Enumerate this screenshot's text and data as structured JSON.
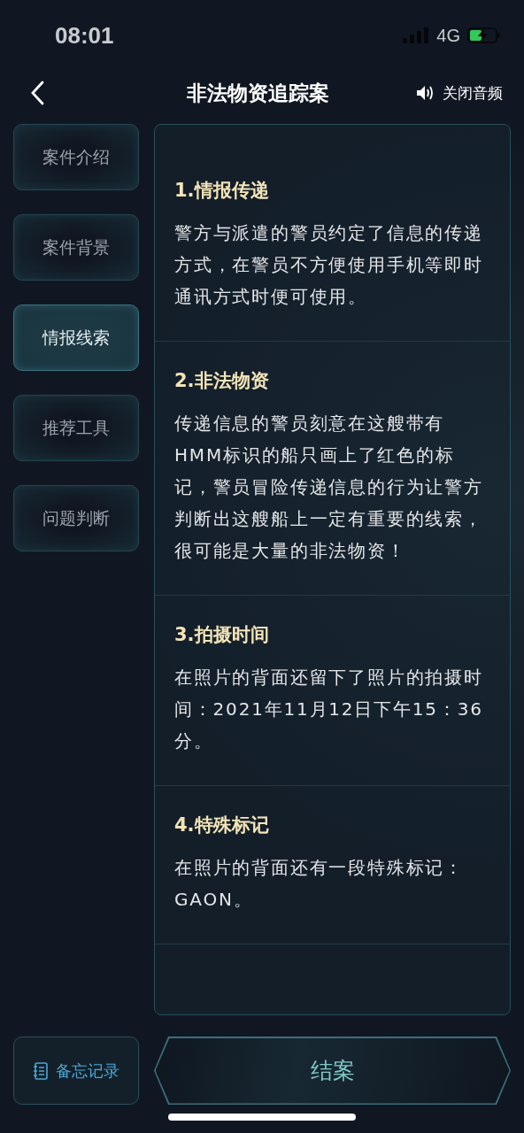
{
  "status_bar": {
    "time": "08:01",
    "network": "4G",
    "charging": true
  },
  "header": {
    "title": "非法物资追踪案",
    "audio_label": "关闭音频"
  },
  "sidebar": {
    "items": [
      {
        "label": "案件介绍",
        "selected": false
      },
      {
        "label": "案件背景",
        "selected": false
      },
      {
        "label": "情报线索",
        "selected": true
      },
      {
        "label": "推荐工具",
        "selected": false
      },
      {
        "label": "问题判断",
        "selected": false
      }
    ]
  },
  "sections": [
    {
      "title": "1.情报传递",
      "body": "警方与派遣的警员约定了信息的传递方式，在警员不方便使用手机等即时通讯方式时便可使用。"
    },
    {
      "title": "2.非法物资",
      "body": "传递信息的警员刻意在这艘带有HMM标识的船只画上了红色的标记，警员冒险传递信息的行为让警方判断出这艘船上一定有重要的线索，很可能是大量的非法物资！"
    },
    {
      "title": "3.拍摄时间",
      "body": "在照片的背面还留下了照片的拍摄时间：2021年11月12日下午15：36分。"
    },
    {
      "title": "4.特殊标记",
      "body": "在照片的背面还有一段特殊标记：GAON。"
    }
  ],
  "footer": {
    "memo_label": "备忘记录",
    "close_label": "结案"
  }
}
